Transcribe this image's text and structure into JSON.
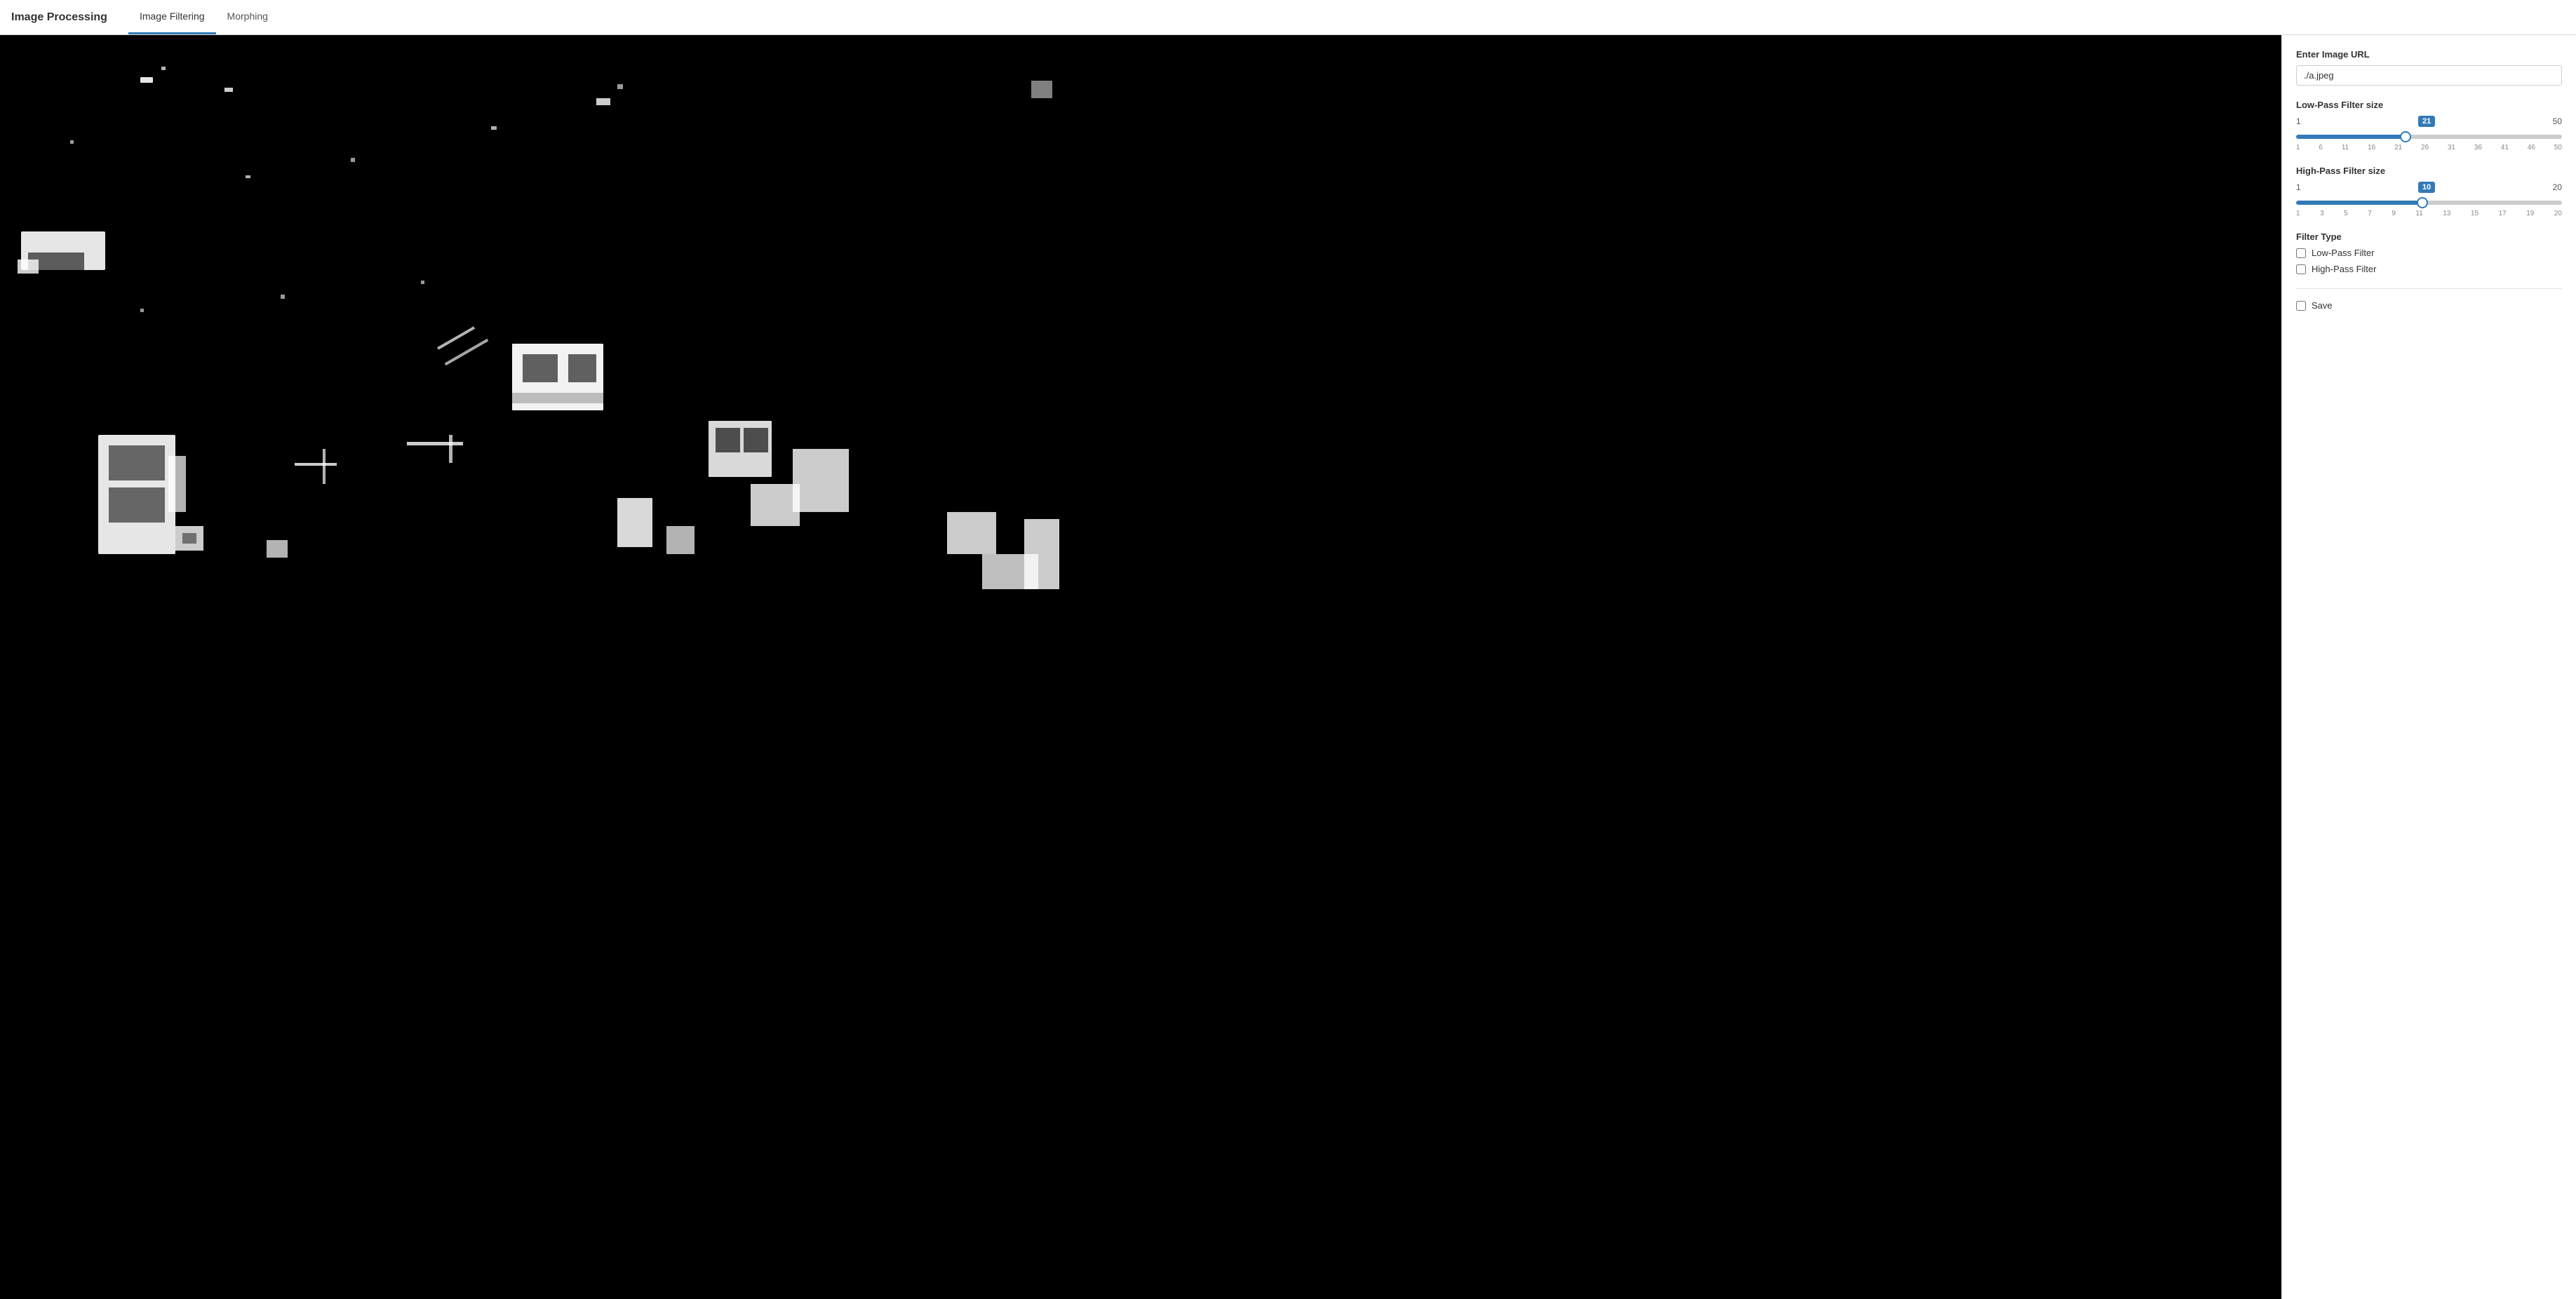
{
  "nav": {
    "brand": "Image Processing",
    "tabs": [
      {
        "label": "Image Filtering",
        "active": true
      },
      {
        "label": "Morphing",
        "active": false
      }
    ]
  },
  "panel": {
    "url_label": "Enter Image URL",
    "url_value": "./a.jpeg",
    "url_placeholder": "./a.jpeg",
    "low_pass": {
      "label": "Low-Pass Filter size",
      "min": 1,
      "max": 50,
      "value": 21,
      "ticks": [
        "1",
        "6",
        "11",
        "16",
        "21",
        "26",
        "31",
        "36",
        "41",
        "46",
        "50"
      ]
    },
    "high_pass": {
      "label": "High-Pass Filter size",
      "min": 1,
      "max": 20,
      "value": 10,
      "ticks": [
        "1",
        "3",
        "5",
        "7",
        "9",
        "11",
        "13",
        "15",
        "17",
        "19",
        "20"
      ]
    },
    "filter_type_label": "Filter Type",
    "filters": [
      {
        "label": "Low-Pass Filter",
        "checked": false
      },
      {
        "label": "High-Pass Filter",
        "checked": false
      }
    ],
    "save_label": "Save"
  }
}
